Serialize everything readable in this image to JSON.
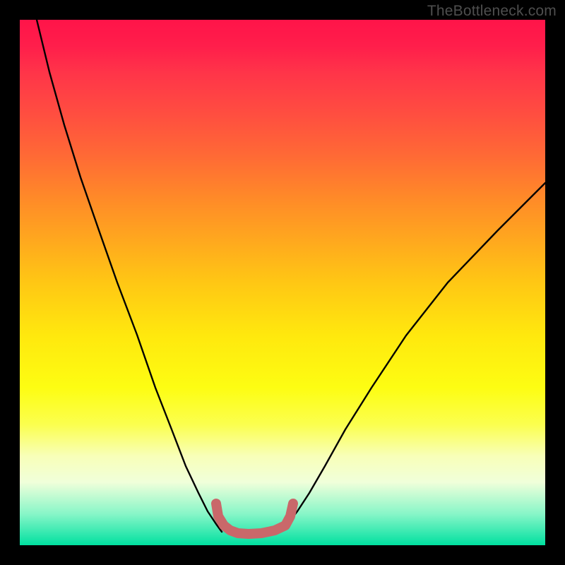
{
  "watermark": "TheBottleneck.com",
  "chart_data": {
    "type": "line",
    "title": "",
    "xlabel": "",
    "ylabel": "",
    "xlim": [
      0,
      1
    ],
    "ylim": [
      0,
      1
    ],
    "series": [
      {
        "name": "curve-left",
        "x": [
          0.032,
          0.057,
          0.085,
          0.115,
          0.15,
          0.186,
          0.223,
          0.258,
          0.289,
          0.316,
          0.34,
          0.358,
          0.373,
          0.385
        ],
        "y": [
          0.0,
          0.1,
          0.2,
          0.3,
          0.4,
          0.5,
          0.6,
          0.7,
          0.78,
          0.85,
          0.9,
          0.935,
          0.96,
          0.975
        ]
      },
      {
        "name": "curve-right",
        "x": [
          0.495,
          0.51,
          0.528,
          0.551,
          0.581,
          0.62,
          0.67,
          0.735,
          0.815,
          0.91,
          1.0
        ],
        "y": [
          0.975,
          0.96,
          0.935,
          0.9,
          0.85,
          0.78,
          0.7,
          0.6,
          0.5,
          0.4,
          0.31
        ]
      },
      {
        "name": "bottom-highlight",
        "x": [
          0.373,
          0.378,
          0.388,
          0.4,
          0.415,
          0.435,
          0.46,
          0.485,
          0.505,
          0.515,
          0.52
        ],
        "y": [
          0.92,
          0.945,
          0.962,
          0.972,
          0.977,
          0.978,
          0.977,
          0.972,
          0.962,
          0.945,
          0.92
        ]
      }
    ],
    "colors": {
      "curve": "#000000",
      "highlight": "#c9686a",
      "background_top": "#ff1449",
      "background_bottom": "#00e0a0"
    }
  }
}
